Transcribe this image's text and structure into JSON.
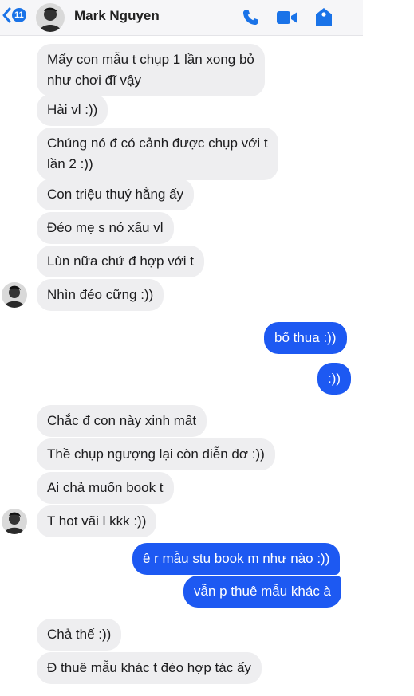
{
  "header": {
    "unread_count": "11",
    "contact_name": "Mark Nguyen",
    "icons": [
      "back-chevron-icon",
      "phone-icon",
      "video-icon",
      "info-icon"
    ]
  },
  "colors": {
    "accent": "#1d59f2",
    "incoming_bubble": "#eeeef0"
  },
  "messages": [
    {
      "from": "them",
      "text_lines": [
        "Mấy con mẫu t chụp 1 lần xong bỏ",
        "như chơi đĩ vậy"
      ]
    },
    {
      "from": "them",
      "text_lines": [
        "Hài vl :))"
      ]
    },
    {
      "from": "them",
      "text_lines": [
        "Chúng nó đ có cảnh được chụp với t",
        "lần 2 :))"
      ]
    },
    {
      "from": "them",
      "text_lines": [
        "Con triệu thuý hằng ấy"
      ]
    },
    {
      "from": "them",
      "text_lines": [
        "Đéo mẹ s nó xấu vl"
      ]
    },
    {
      "from": "them",
      "text_lines": [
        "Lùn nữa chứ đ hợp với t"
      ]
    },
    {
      "from": "them",
      "text_lines": [
        "Nhìn đéo cững :))"
      ]
    },
    {
      "from": "me",
      "text_lines": [
        "bố thua :))"
      ]
    },
    {
      "from": "me",
      "text_lines": [
        ":))"
      ]
    },
    {
      "from": "them",
      "text_lines": [
        "Chắc đ con này xinh mất"
      ]
    },
    {
      "from": "them",
      "text_lines": [
        "Thề chụp ngượng lại còn diễn đơ :))"
      ]
    },
    {
      "from": "them",
      "text_lines": [
        "Ai chả muốn book t"
      ]
    },
    {
      "from": "them",
      "text_lines": [
        "T hot vãi l kkk :))"
      ]
    },
    {
      "from": "me",
      "text_lines": [
        "ê r mẫu stu book m như nào :))"
      ]
    },
    {
      "from": "me",
      "text_lines": [
        "vẫn p thuê mẫu khác à"
      ]
    },
    {
      "from": "them",
      "text_lines": [
        "Chả thế :))"
      ]
    },
    {
      "from": "them",
      "text_lines": [
        "Đ thuê mẫu khác t đéo hợp tác ấy"
      ]
    }
  ]
}
